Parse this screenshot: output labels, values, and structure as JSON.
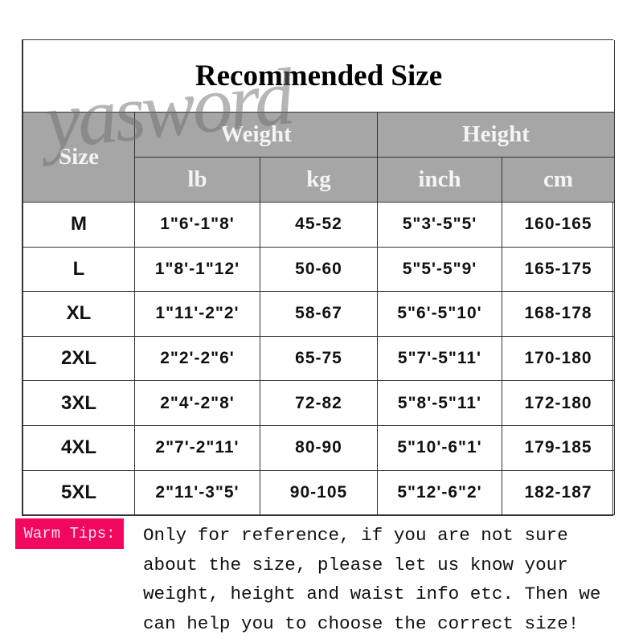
{
  "title": "Recommended Size",
  "watermark": "yasword",
  "headers": {
    "size": "Size",
    "weight": "Weight",
    "height": "Height",
    "lb": "lb",
    "kg": "kg",
    "inch": "inch",
    "cm": "cm"
  },
  "rows": [
    {
      "size": "M",
      "lb": "1\"6'-1\"8'",
      "kg": "45-52",
      "inch": "5\"3'-5\"5'",
      "cm": "160-165"
    },
    {
      "size": "L",
      "lb": "1\"8'-1\"12'",
      "kg": "50-60",
      "inch": "5\"5'-5\"9'",
      "cm": "165-175"
    },
    {
      "size": "XL",
      "lb": "1\"11'-2\"2'",
      "kg": "58-67",
      "inch": "5\"6'-5\"10'",
      "cm": "168-178"
    },
    {
      "size": "2XL",
      "lb": "2\"2'-2\"6'",
      "kg": "65-75",
      "inch": "5\"7'-5\"11'",
      "cm": "170-180"
    },
    {
      "size": "3XL",
      "lb": "2\"4'-2\"8'",
      "kg": "72-82",
      "inch": "5\"8'-5\"11'",
      "cm": "172-180"
    },
    {
      "size": "4XL",
      "lb": "2\"7'-2\"11'",
      "kg": "80-90",
      "inch": "5\"10'-6\"1'",
      "cm": "179-185"
    },
    {
      "size": "5XL",
      "lb": "2\"11'-3\"5'",
      "kg": "90-105",
      "inch": "5\"12'-6\"2'",
      "cm": "182-187"
    }
  ],
  "tips": {
    "label": "Warm Tips:",
    "text": "Only for reference, if you are not sure\nabout the size, please let us know your\nweight, height and  waist info etc. Then we\ncan help you to choose the correct size!"
  },
  "colors": {
    "header_bg": "#a6a6a6",
    "tips_badge": "#f2075f"
  }
}
